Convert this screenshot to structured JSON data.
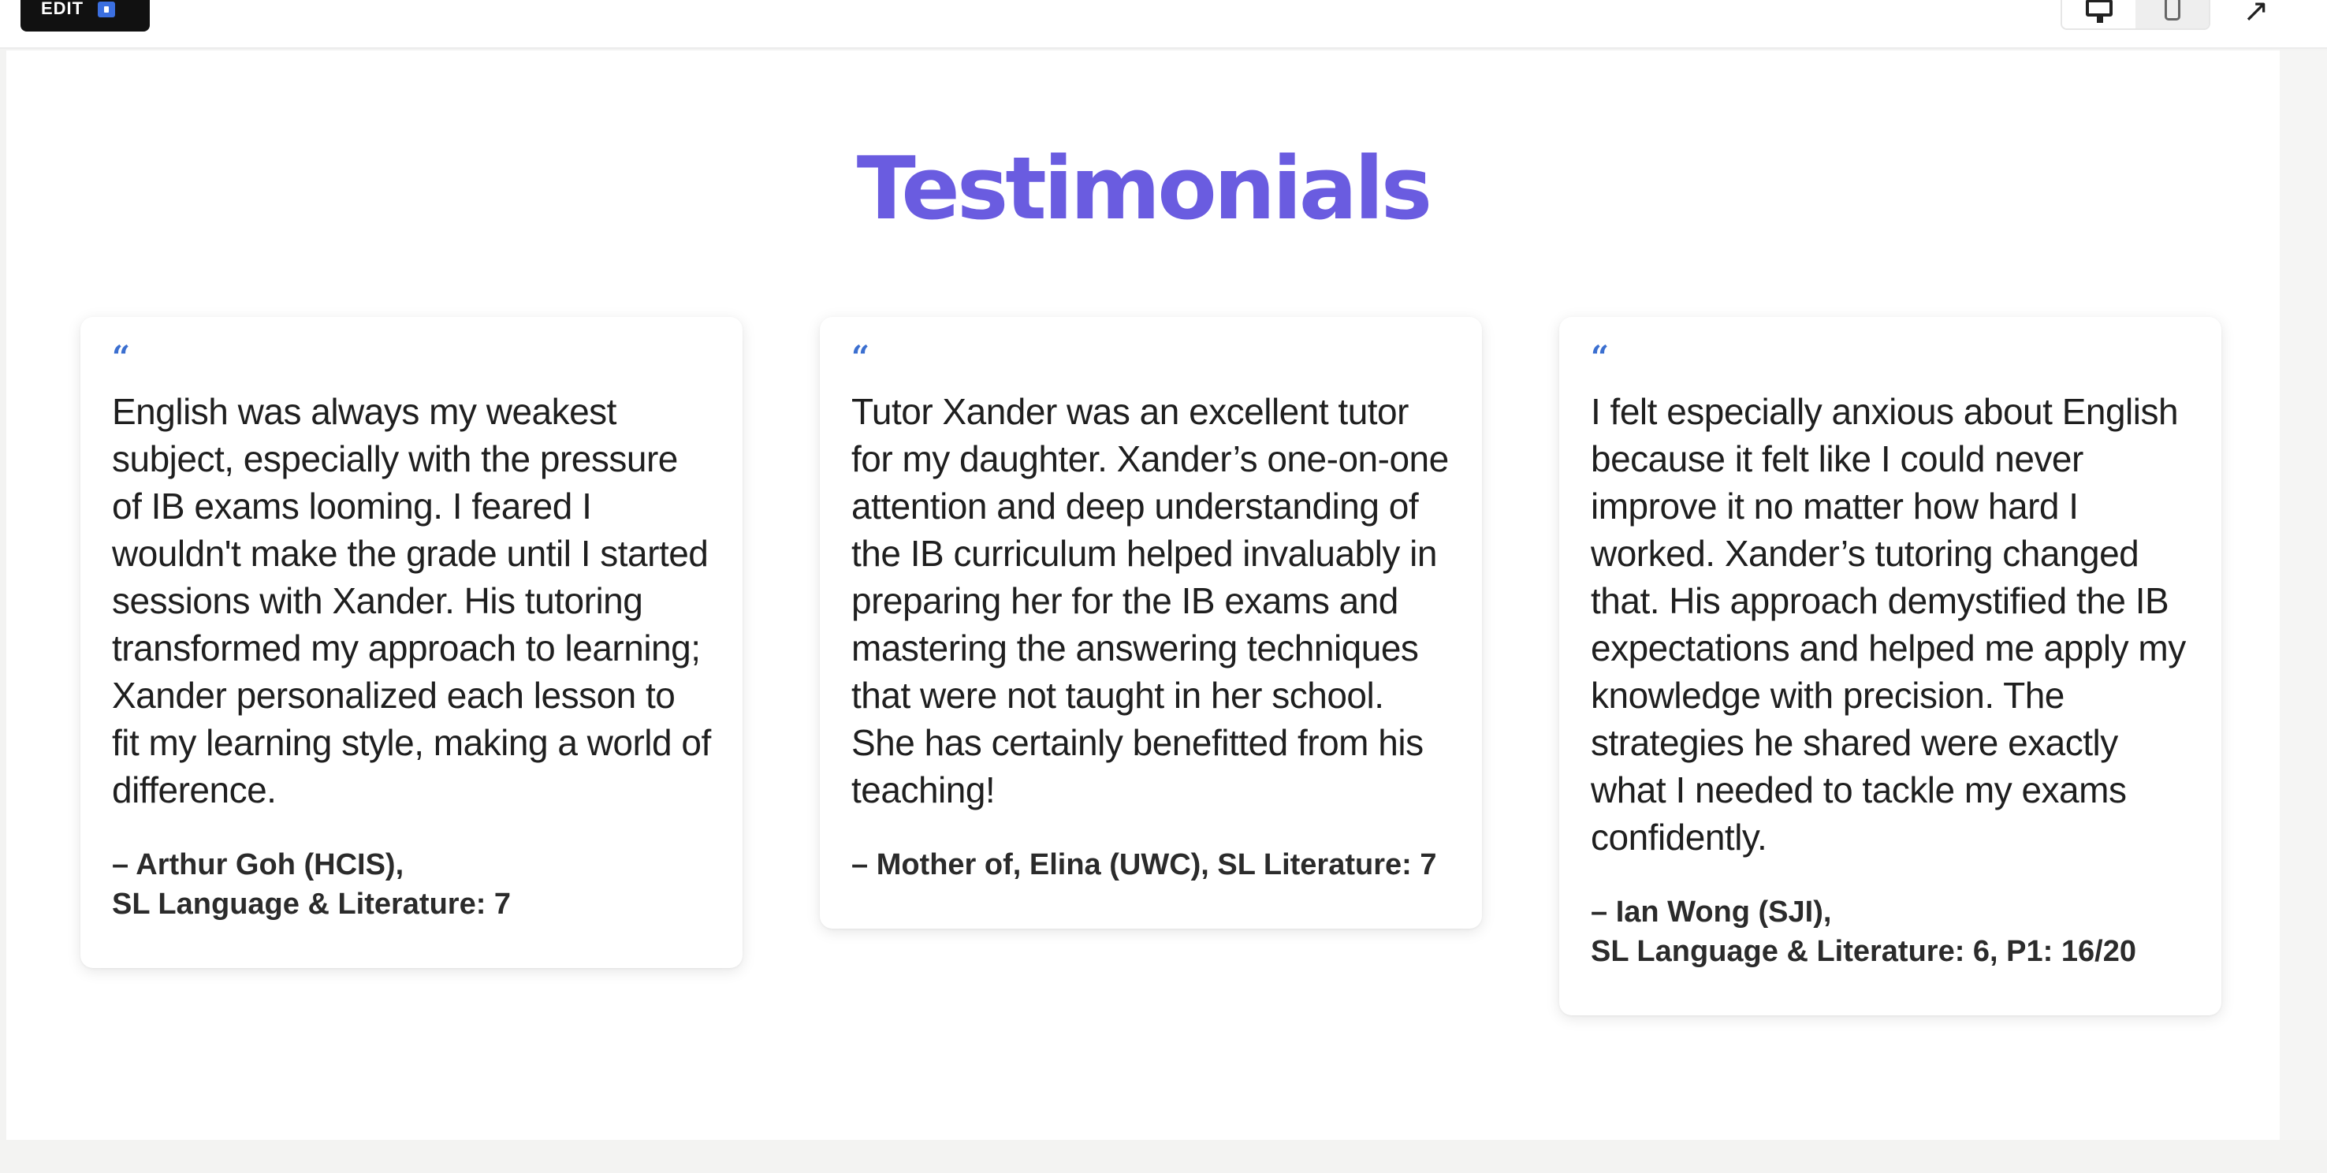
{
  "editor": {
    "edit_label": "EDIT",
    "lock_icon": "lock-icon",
    "desktop_icon": "desktop-icon",
    "mobile_icon": "mobile-icon",
    "expand_icon": "arrow-up-right-icon",
    "expand_glyph": "↗"
  },
  "section": {
    "title": "Testimonials"
  },
  "testimonials": [
    {
      "quote_mark": "“",
      "text": "English was always my weakest subject, especially with the pressure of IB exams looming. I feared I wouldn't make the grade until I started sessions with Xander. His tutoring transformed my approach to learning; Xander personalized each lesson to fit my learning style, making a world of difference.",
      "author": "– Arthur Goh (HCIS),\nSL Language & Literature: 7"
    },
    {
      "quote_mark": "“",
      "text": "Tutor Xander was an excellent tutor for my daughter. Xander’s one-on-one attention and deep understanding of the IB curriculum helped invaluably in preparing her for the IB exams and mastering the answering techniques that were not taught in her school. She has certainly benefitted from his teaching!",
      "author": "– Mother of, Elina (UWC), SL Literature: 7"
    },
    {
      "quote_mark": "“",
      "text": "I felt especially anxious about English because it felt like I could never improve it no matter how hard I worked. Xander’s tutoring changed that. His approach demystified the IB expectations and helped me apply my knowledge with precision. The strategies he shared were exactly what I needed to tackle my exams confidently.",
      "author": "– Ian Wong (SJI),\nSL Language & Literature: 6, P1: 16/20"
    }
  ],
  "colors": {
    "title": "#6a5ce0",
    "quote_mark": "#3b6fd0",
    "edit_button_bg": "#111111"
  }
}
